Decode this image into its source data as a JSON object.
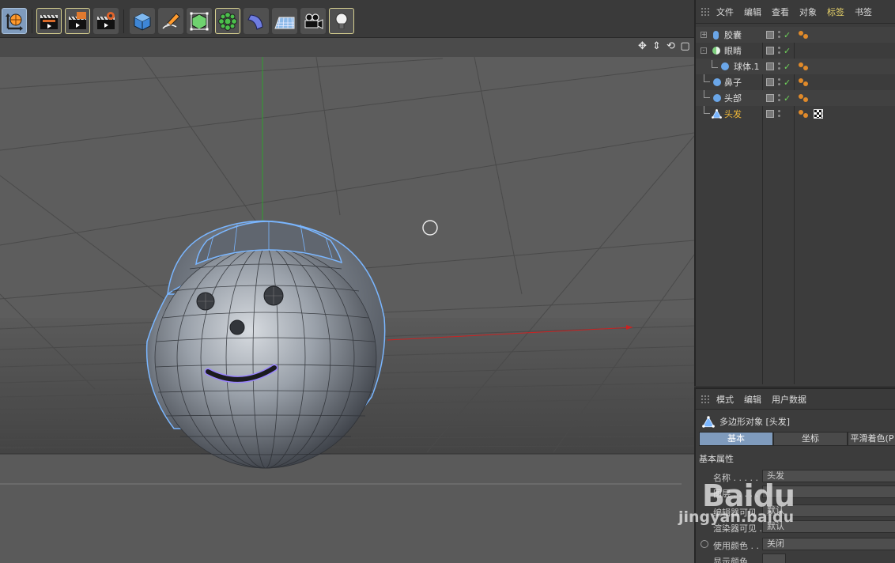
{
  "toolbar": {
    "tools": [
      {
        "name": "coordinate-system"
      },
      {
        "name": "render-view"
      },
      {
        "name": "render-to-picture-viewer"
      },
      {
        "name": "render-settings"
      },
      {
        "name": "cube-primitive"
      },
      {
        "name": "pen-spline"
      },
      {
        "name": "subdivision-generator"
      },
      {
        "name": "cloner"
      },
      {
        "name": "deformer"
      },
      {
        "name": "floor"
      },
      {
        "name": "camera"
      },
      {
        "name": "light"
      }
    ]
  },
  "viewport": {
    "nav_icons": [
      "move-view-icon",
      "dolly-view-icon",
      "rotate-view-icon",
      "toggle-view-icon"
    ]
  },
  "object_manager": {
    "menu": [
      "文件",
      "编辑",
      "查看",
      "对象",
      "标签",
      "书签"
    ],
    "active_menu": "标签",
    "objects": [
      {
        "name": "胶囊",
        "icon": "capsule-icon",
        "color": "#6aa6e8",
        "expand": "+",
        "selected": false
      },
      {
        "name": "眼睛",
        "icon": "null-group-icon",
        "color": "#7fd07f",
        "expand": "-",
        "selected": false
      },
      {
        "name": "球体.1",
        "icon": "sphere-icon",
        "color": "#6aa6e8",
        "expand": "",
        "selected": false
      },
      {
        "name": "鼻子",
        "icon": "sphere-icon",
        "color": "#6aa6e8",
        "expand": "",
        "selected": false
      },
      {
        "name": "头部",
        "icon": "sphere-icon",
        "color": "#6aa6e8",
        "expand": "",
        "selected": false
      },
      {
        "name": "头发",
        "icon": "polygon-object-icon",
        "color": "#7ab6ff",
        "expand": "",
        "selected": true
      }
    ]
  },
  "attribute_manager": {
    "menu": [
      "模式",
      "编辑",
      "用户数据"
    ],
    "title": "多边形对象 [头发]",
    "tabs": [
      "基本",
      "坐标",
      "平滑着色(P"
    ],
    "active_tab": "基本",
    "section": "基本属性",
    "fields": [
      {
        "label": "名称 . . . . .",
        "value": "头发"
      },
      {
        "label": "图层 . . . . .",
        "value": ""
      },
      {
        "label": "编辑器可见 .",
        "value": "默认"
      },
      {
        "label": "渲染器可见 .",
        "value": "默认"
      },
      {
        "label": "使用颜色 . . .",
        "value": "关闭"
      },
      {
        "label": "显示颜色 . . .",
        "value": ""
      }
    ]
  },
  "watermark": {
    "logo": "Baidu",
    "text": "jingyan.baidu"
  }
}
